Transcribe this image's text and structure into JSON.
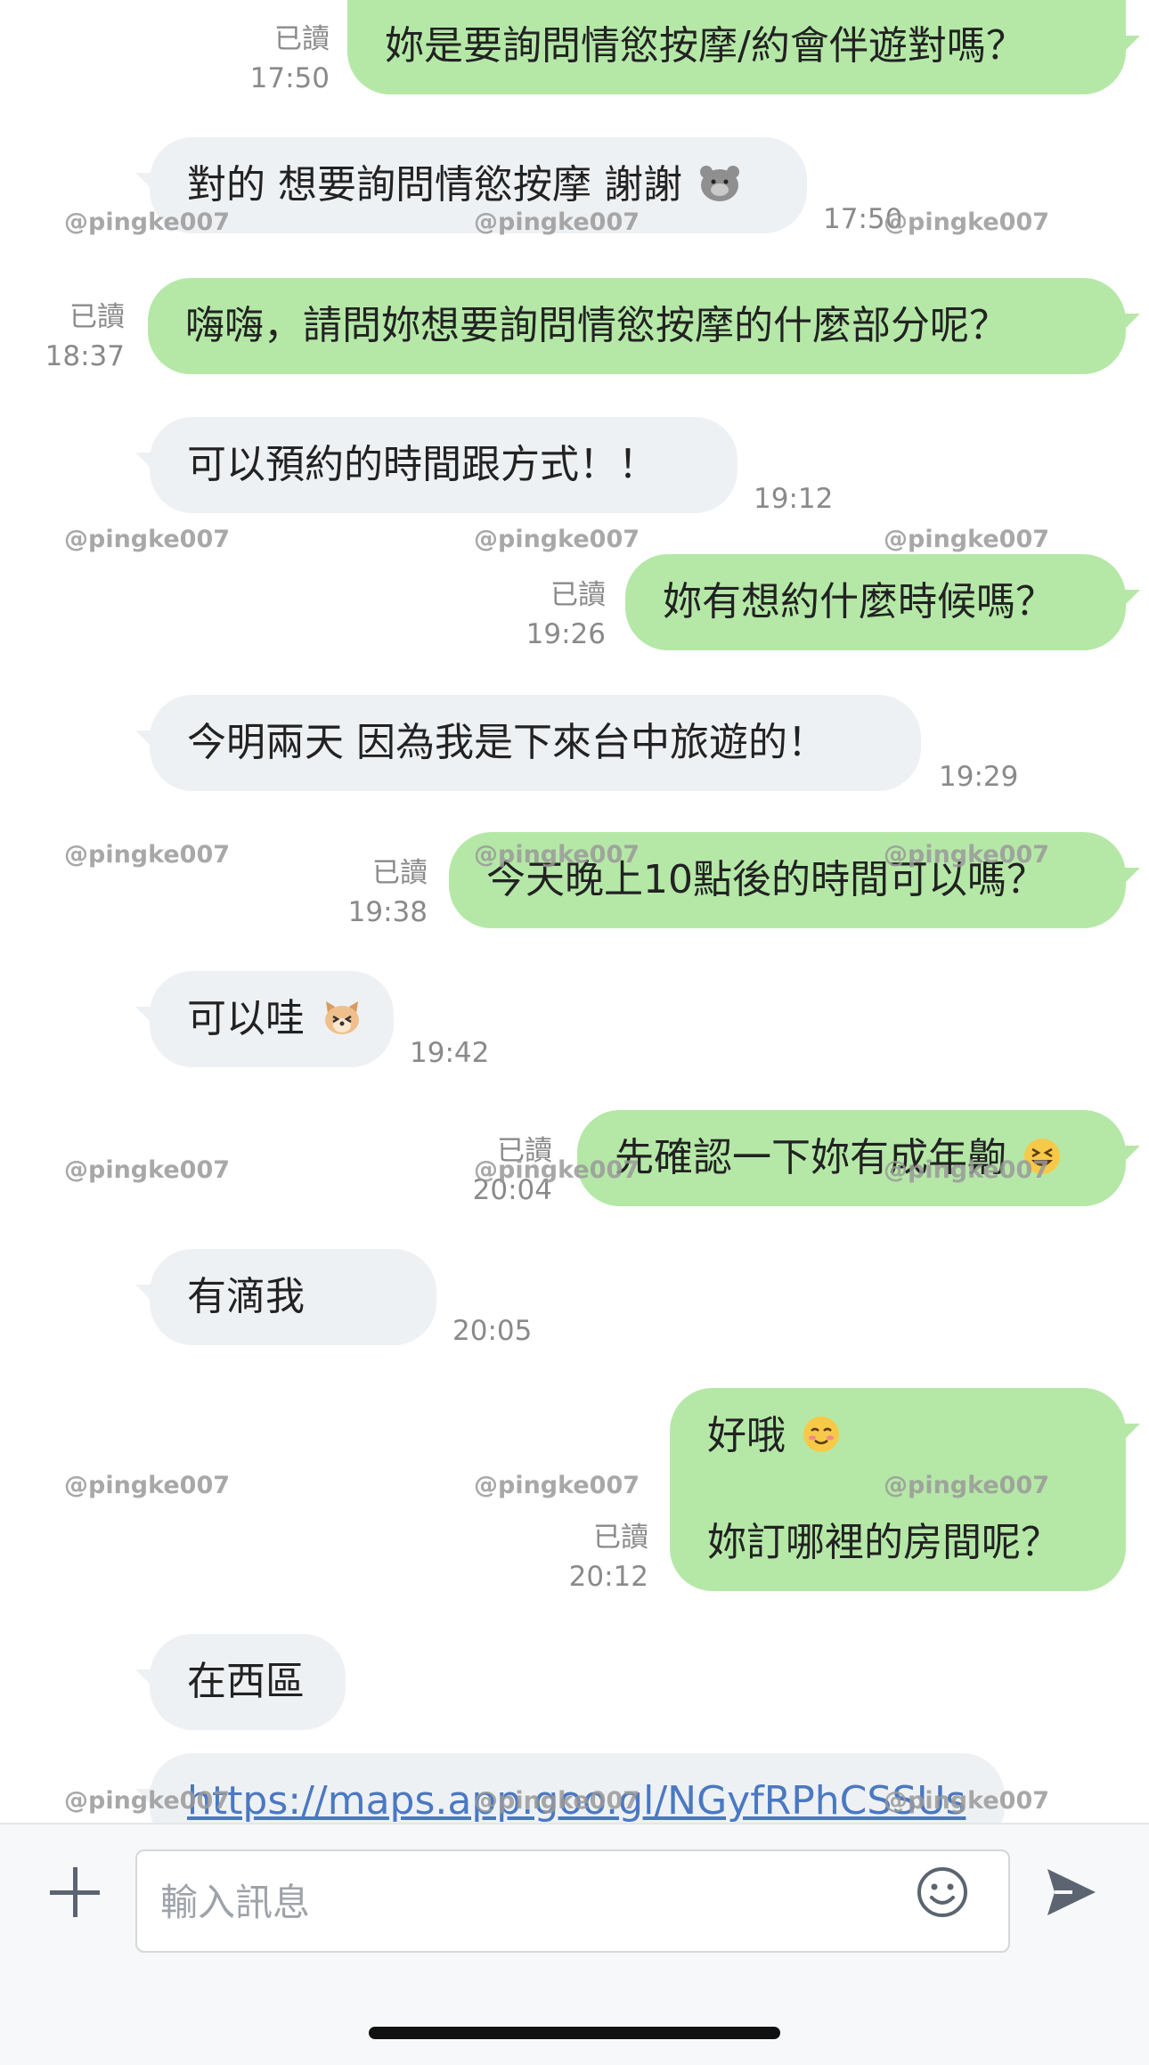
{
  "watermark": "@pingke007",
  "messages": [
    {
      "side": "out",
      "text": "妳是要詢問情慾按摩/約會伴遊對嗎？",
      "read": "已讀",
      "time": "17:50"
    },
    {
      "side": "in",
      "text": "對的 想要詢問情慾按摩 謝謝",
      "emoji": "bear-sticker-icon",
      "time": "17:50"
    },
    {
      "side": "out",
      "text": "嗨嗨，請問妳想要詢問情慾按摩的什麼部分呢？",
      "read": "已讀",
      "time": "18:37"
    },
    {
      "side": "in",
      "text": "可以預約的時間跟方式！！",
      "time": "19:12"
    },
    {
      "side": "out",
      "text": "妳有想約什麼時候嗎？",
      "read": "已讀",
      "time": "19:26"
    },
    {
      "side": "in",
      "text": "今明兩天 因為我是下來台中旅遊的！",
      "time": "19:29"
    },
    {
      "side": "out",
      "text": "今天晚上10點後的時間可以嗎？",
      "read": "已讀",
      "time": "19:38"
    },
    {
      "side": "in",
      "text": "可以哇",
      "emoji": "dog-face-icon",
      "time": "19:42"
    },
    {
      "side": "out",
      "text": "先確認一下妳有成年齁",
      "emoji": "grinning-squint-icon",
      "read": "已讀",
      "time": "20:04"
    },
    {
      "side": "in",
      "text": "有滴我",
      "time": "20:05"
    },
    {
      "side": "out",
      "text": "好哦",
      "emoji": "smiling-blush-icon",
      "text2": "妳訂哪裡的房間呢？",
      "read": "已讀",
      "time": "20:12"
    },
    {
      "side": "in",
      "text": "在西區"
    },
    {
      "side": "in",
      "text": "https://maps.app.goo.gl/NGyfRPhCSSUs"
    }
  ],
  "input": {
    "placeholder": "輸入訊息"
  },
  "icons": {
    "add": "plus-icon",
    "emoji": "smiley-icon",
    "send": "send-arrow-icon"
  },
  "colors": {
    "outgoing_bubble": "#b5e8a7",
    "incoming_bubble": "#eef1f4",
    "link": "#4a78c2"
  }
}
